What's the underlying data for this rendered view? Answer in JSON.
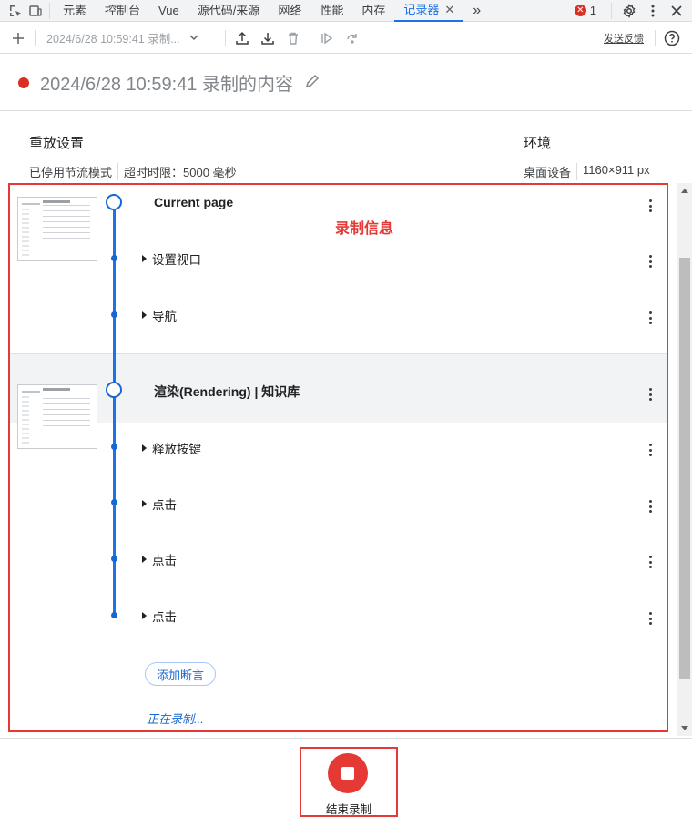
{
  "tabbar": {
    "tabs": [
      "元素",
      "控制台",
      "Vue",
      "源代码/来源",
      "网络",
      "性能",
      "内存"
    ],
    "active_tab": "记录器",
    "more": "»",
    "error_count": "1"
  },
  "toolbar": {
    "recording_select": "2024/6/28 10:59:41 录制...",
    "feedback": "发送反馈"
  },
  "recording": {
    "title": "2024/6/28 10:59:41 录制的内容"
  },
  "replay_settings": {
    "heading": "重放设置",
    "throttling": "已停用节流模式",
    "timeout": "超时时限：5000 毫秒"
  },
  "environment": {
    "heading": "环境",
    "device": "桌面设备",
    "viewport": "1160×911 px"
  },
  "annotation": "录制信息",
  "sections": [
    {
      "title": "Current page",
      "steps": [
        "设置视口",
        "导航"
      ]
    },
    {
      "title": "渲染(Rendering) | 知识库",
      "steps": [
        "释放按键",
        "点击",
        "点击",
        "点击"
      ]
    }
  ],
  "add_assertion": "添加断言",
  "recording_status": "正在录制...",
  "stop": {
    "label": "结束录制"
  }
}
